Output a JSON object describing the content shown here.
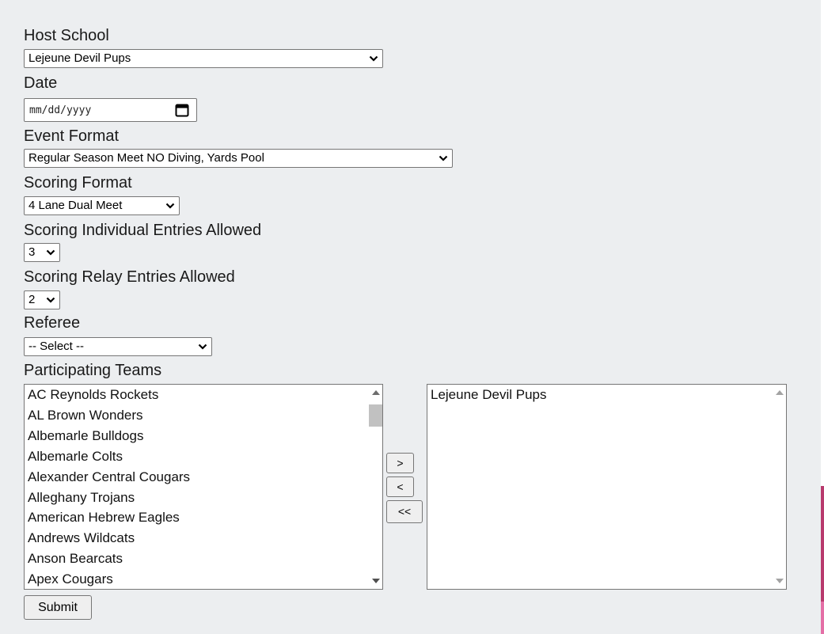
{
  "form": {
    "host_school": {
      "label": "Host School",
      "value": "Lejeune Devil Pups"
    },
    "date": {
      "label": "Date",
      "placeholder": "mm/dd/yyyy"
    },
    "event_format": {
      "label": "Event Format",
      "value": "Regular Season Meet NO Diving, Yards Pool"
    },
    "scoring_format": {
      "label": "Scoring Format",
      "value": "4 Lane Dual Meet"
    },
    "individual_entries": {
      "label": "Scoring Individual Entries Allowed",
      "value": "3"
    },
    "relay_entries": {
      "label": "Scoring Relay Entries Allowed",
      "value": "2"
    },
    "referee": {
      "label": "Referee",
      "value": "-- Select --"
    },
    "participating_teams": {
      "label": "Participating Teams",
      "available": [
        "AC Reynolds Rockets",
        "AL Brown Wonders",
        "Albemarle Bulldogs",
        "Albemarle Colts",
        "Alexander Central Cougars",
        "Alleghany Trojans",
        "American Hebrew Eagles",
        "Andrews Wildcats",
        "Anson Bearcats",
        "Apex Cougars"
      ],
      "selected": [
        "Lejeune Devil Pups"
      ],
      "add_label": ">",
      "remove_label": "<",
      "remove_all_label": "<<"
    },
    "submit_label": "Submit"
  },
  "icons": {
    "dropdown": "chevron-down-icon",
    "calendar": "calendar-icon",
    "scroll_up": "scroll-up-arrow-icon",
    "scroll_down": "scroll-down-arrow-icon"
  },
  "colors": {
    "page_background": "#eceef0",
    "accent_edge_dark": "#b83a6d",
    "accent_edge_light": "#e46fa6"
  }
}
